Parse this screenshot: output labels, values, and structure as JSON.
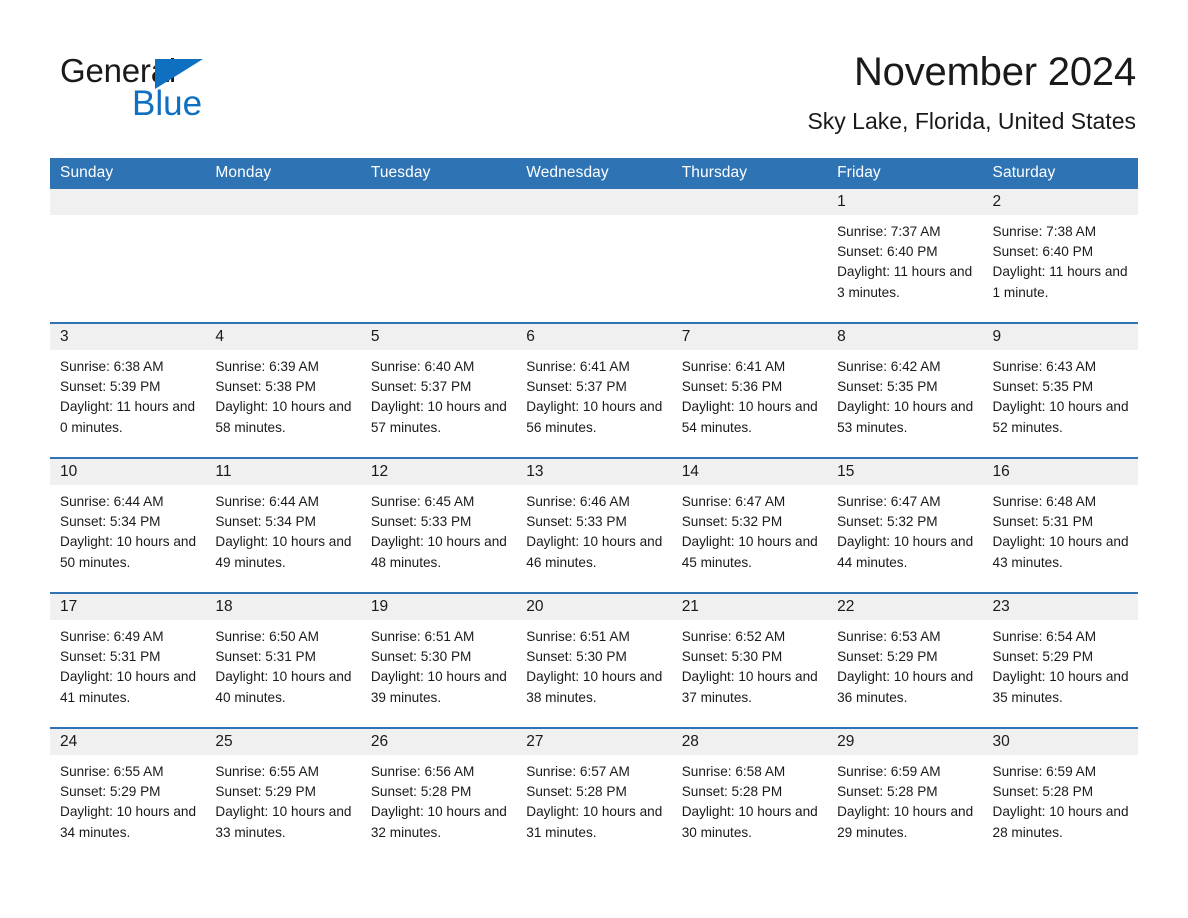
{
  "brand": {
    "name_part1": "General",
    "name_part2": "Blue",
    "logo_triangle_color": "#0f6fc0"
  },
  "header": {
    "title": "November 2024",
    "subtitle": "Sky Lake, Florida, United States"
  },
  "theme": {
    "header_blue": "#2e74b5",
    "daynum_band": "#f0f0f0",
    "text": "#1a1a1a"
  },
  "columns": [
    "Sunday",
    "Monday",
    "Tuesday",
    "Wednesday",
    "Thursday",
    "Friday",
    "Saturday"
  ],
  "labels": {
    "sunrise_prefix": "Sunrise:",
    "sunset_prefix": "Sunset:",
    "daylight_prefix": "Daylight:"
  },
  "weeks": [
    [
      {
        "day": "",
        "empty": true
      },
      {
        "day": "",
        "empty": true
      },
      {
        "day": "",
        "empty": true
      },
      {
        "day": "",
        "empty": true
      },
      {
        "day": "",
        "empty": true
      },
      {
        "day": "1",
        "sunrise": "Sunrise: 7:37 AM",
        "sunset": "Sunset: 6:40 PM",
        "daylight": "Daylight: 11 hours and 3 minutes."
      },
      {
        "day": "2",
        "sunrise": "Sunrise: 7:38 AM",
        "sunset": "Sunset: 6:40 PM",
        "daylight": "Daylight: 11 hours and 1 minute."
      }
    ],
    [
      {
        "day": "3",
        "sunrise": "Sunrise: 6:38 AM",
        "sunset": "Sunset: 5:39 PM",
        "daylight": "Daylight: 11 hours and 0 minutes."
      },
      {
        "day": "4",
        "sunrise": "Sunrise: 6:39 AM",
        "sunset": "Sunset: 5:38 PM",
        "daylight": "Daylight: 10 hours and 58 minutes."
      },
      {
        "day": "5",
        "sunrise": "Sunrise: 6:40 AM",
        "sunset": "Sunset: 5:37 PM",
        "daylight": "Daylight: 10 hours and 57 minutes."
      },
      {
        "day": "6",
        "sunrise": "Sunrise: 6:41 AM",
        "sunset": "Sunset: 5:37 PM",
        "daylight": "Daylight: 10 hours and 56 minutes."
      },
      {
        "day": "7",
        "sunrise": "Sunrise: 6:41 AM",
        "sunset": "Sunset: 5:36 PM",
        "daylight": "Daylight: 10 hours and 54 minutes."
      },
      {
        "day": "8",
        "sunrise": "Sunrise: 6:42 AM",
        "sunset": "Sunset: 5:35 PM",
        "daylight": "Daylight: 10 hours and 53 minutes."
      },
      {
        "day": "9",
        "sunrise": "Sunrise: 6:43 AM",
        "sunset": "Sunset: 5:35 PM",
        "daylight": "Daylight: 10 hours and 52 minutes."
      }
    ],
    [
      {
        "day": "10",
        "sunrise": "Sunrise: 6:44 AM",
        "sunset": "Sunset: 5:34 PM",
        "daylight": "Daylight: 10 hours and 50 minutes."
      },
      {
        "day": "11",
        "sunrise": "Sunrise: 6:44 AM",
        "sunset": "Sunset: 5:34 PM",
        "daylight": "Daylight: 10 hours and 49 minutes."
      },
      {
        "day": "12",
        "sunrise": "Sunrise: 6:45 AM",
        "sunset": "Sunset: 5:33 PM",
        "daylight": "Daylight: 10 hours and 48 minutes."
      },
      {
        "day": "13",
        "sunrise": "Sunrise: 6:46 AM",
        "sunset": "Sunset: 5:33 PM",
        "daylight": "Daylight: 10 hours and 46 minutes."
      },
      {
        "day": "14",
        "sunrise": "Sunrise: 6:47 AM",
        "sunset": "Sunset: 5:32 PM",
        "daylight": "Daylight: 10 hours and 45 minutes."
      },
      {
        "day": "15",
        "sunrise": "Sunrise: 6:47 AM",
        "sunset": "Sunset: 5:32 PM",
        "daylight": "Daylight: 10 hours and 44 minutes."
      },
      {
        "day": "16",
        "sunrise": "Sunrise: 6:48 AM",
        "sunset": "Sunset: 5:31 PM",
        "daylight": "Daylight: 10 hours and 43 minutes."
      }
    ],
    [
      {
        "day": "17",
        "sunrise": "Sunrise: 6:49 AM",
        "sunset": "Sunset: 5:31 PM",
        "daylight": "Daylight: 10 hours and 41 minutes."
      },
      {
        "day": "18",
        "sunrise": "Sunrise: 6:50 AM",
        "sunset": "Sunset: 5:31 PM",
        "daylight": "Daylight: 10 hours and 40 minutes."
      },
      {
        "day": "19",
        "sunrise": "Sunrise: 6:51 AM",
        "sunset": "Sunset: 5:30 PM",
        "daylight": "Daylight: 10 hours and 39 minutes."
      },
      {
        "day": "20",
        "sunrise": "Sunrise: 6:51 AM",
        "sunset": "Sunset: 5:30 PM",
        "daylight": "Daylight: 10 hours and 38 minutes."
      },
      {
        "day": "21",
        "sunrise": "Sunrise: 6:52 AM",
        "sunset": "Sunset: 5:30 PM",
        "daylight": "Daylight: 10 hours and 37 minutes."
      },
      {
        "day": "22",
        "sunrise": "Sunrise: 6:53 AM",
        "sunset": "Sunset: 5:29 PM",
        "daylight": "Daylight: 10 hours and 36 minutes."
      },
      {
        "day": "23",
        "sunrise": "Sunrise: 6:54 AM",
        "sunset": "Sunset: 5:29 PM",
        "daylight": "Daylight: 10 hours and 35 minutes."
      }
    ],
    [
      {
        "day": "24",
        "sunrise": "Sunrise: 6:55 AM",
        "sunset": "Sunset: 5:29 PM",
        "daylight": "Daylight: 10 hours and 34 minutes."
      },
      {
        "day": "25",
        "sunrise": "Sunrise: 6:55 AM",
        "sunset": "Sunset: 5:29 PM",
        "daylight": "Daylight: 10 hours and 33 minutes."
      },
      {
        "day": "26",
        "sunrise": "Sunrise: 6:56 AM",
        "sunset": "Sunset: 5:28 PM",
        "daylight": "Daylight: 10 hours and 32 minutes."
      },
      {
        "day": "27",
        "sunrise": "Sunrise: 6:57 AM",
        "sunset": "Sunset: 5:28 PM",
        "daylight": "Daylight: 10 hours and 31 minutes."
      },
      {
        "day": "28",
        "sunrise": "Sunrise: 6:58 AM",
        "sunset": "Sunset: 5:28 PM",
        "daylight": "Daylight: 10 hours and 30 minutes."
      },
      {
        "day": "29",
        "sunrise": "Sunrise: 6:59 AM",
        "sunset": "Sunset: 5:28 PM",
        "daylight": "Daylight: 10 hours and 29 minutes."
      },
      {
        "day": "30",
        "sunrise": "Sunrise: 6:59 AM",
        "sunset": "Sunset: 5:28 PM",
        "daylight": "Daylight: 10 hours and 28 minutes."
      }
    ]
  ]
}
